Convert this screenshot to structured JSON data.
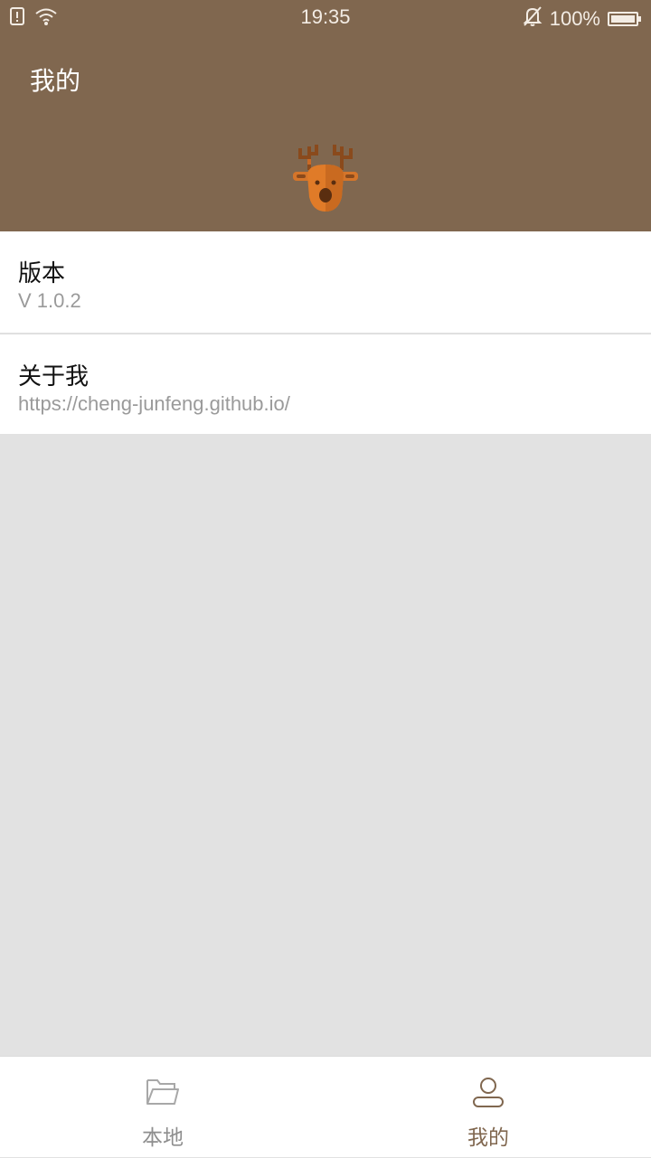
{
  "status_bar": {
    "time": "19:35",
    "battery_text": "100%",
    "battery_level": 1.0,
    "icons": [
      "sim-alert-icon",
      "wifi-icon",
      "bell-muted-icon",
      "battery-icon"
    ]
  },
  "header": {
    "title": "我的",
    "logo_icon": "deer-icon",
    "background": "#80674f"
  },
  "settings": {
    "items": [
      {
        "title": "版本",
        "subtitle": "V 1.0.2"
      },
      {
        "title": "关于我",
        "subtitle": "https://cheng-junfeng.github.io/"
      }
    ]
  },
  "bottom_nav": {
    "tabs": [
      {
        "label": "本地",
        "icon": "folder-icon",
        "active": false
      },
      {
        "label": "我的",
        "icon": "user-icon",
        "active": true
      }
    ],
    "active_color": "#80674f",
    "inactive_color": "#8e8e8e"
  }
}
